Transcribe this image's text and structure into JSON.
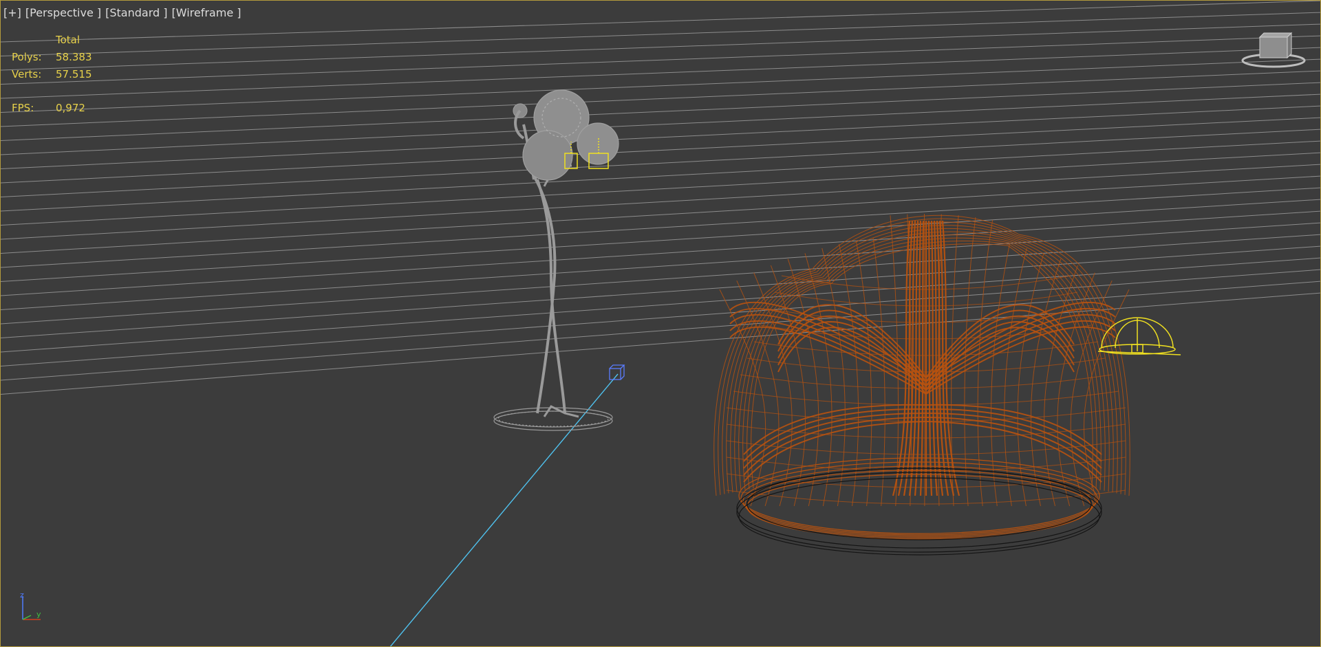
{
  "viewport": {
    "labels": [
      "[+]",
      "[Perspective ]",
      "[Standard ]",
      "[Wireframe ]"
    ]
  },
  "stats": {
    "header": "Total",
    "polys_label": "Polys:",
    "polys_value": "58.383",
    "verts_label": "Verts:",
    "verts_value": "57.515",
    "fps_label": "FPS:",
    "fps_value": "0,972"
  },
  "axis": {
    "z": "z",
    "y": "y"
  },
  "colors": {
    "background": "#3c3c3c",
    "grid_line": "#a8a8a8",
    "stats_text": "#e8d24a",
    "chair_wire": "#b8520f",
    "lamp_wire": "#9a9a9a",
    "selection": "#f0e020",
    "camera_line": "#4fc3f0",
    "camera_box": "#5a7cff"
  },
  "icons": {
    "viewcube": "viewcube-icon",
    "light": "light-icon",
    "camera": "camera-target-icon"
  }
}
